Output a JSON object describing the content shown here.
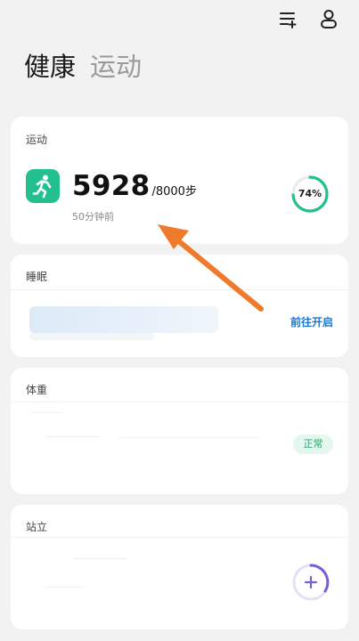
{
  "header": {
    "menu_icon": "list-add-icon",
    "profile_icon": "user-icon",
    "title": "健康",
    "title_secondary": "运动"
  },
  "sport": {
    "title": "运动",
    "icon": "running-person-icon",
    "steps": "5928",
    "goal": "/8000步",
    "time_ago": "50分钟前",
    "progress_label": "74%",
    "progress": 0.74,
    "accent_color": "#23c08d"
  },
  "sleep": {
    "title": "睡眠",
    "action_label": "前往开启",
    "action_color": "#1976d2"
  },
  "weight": {
    "title": "体重",
    "status_label": "正常",
    "status_color": "#27a86f"
  },
  "stand": {
    "title": "站立",
    "add_icon": "plus-icon",
    "ring_color": "#7b5fcf"
  },
  "annotation": {
    "arrow_color": "#f07a2c"
  }
}
